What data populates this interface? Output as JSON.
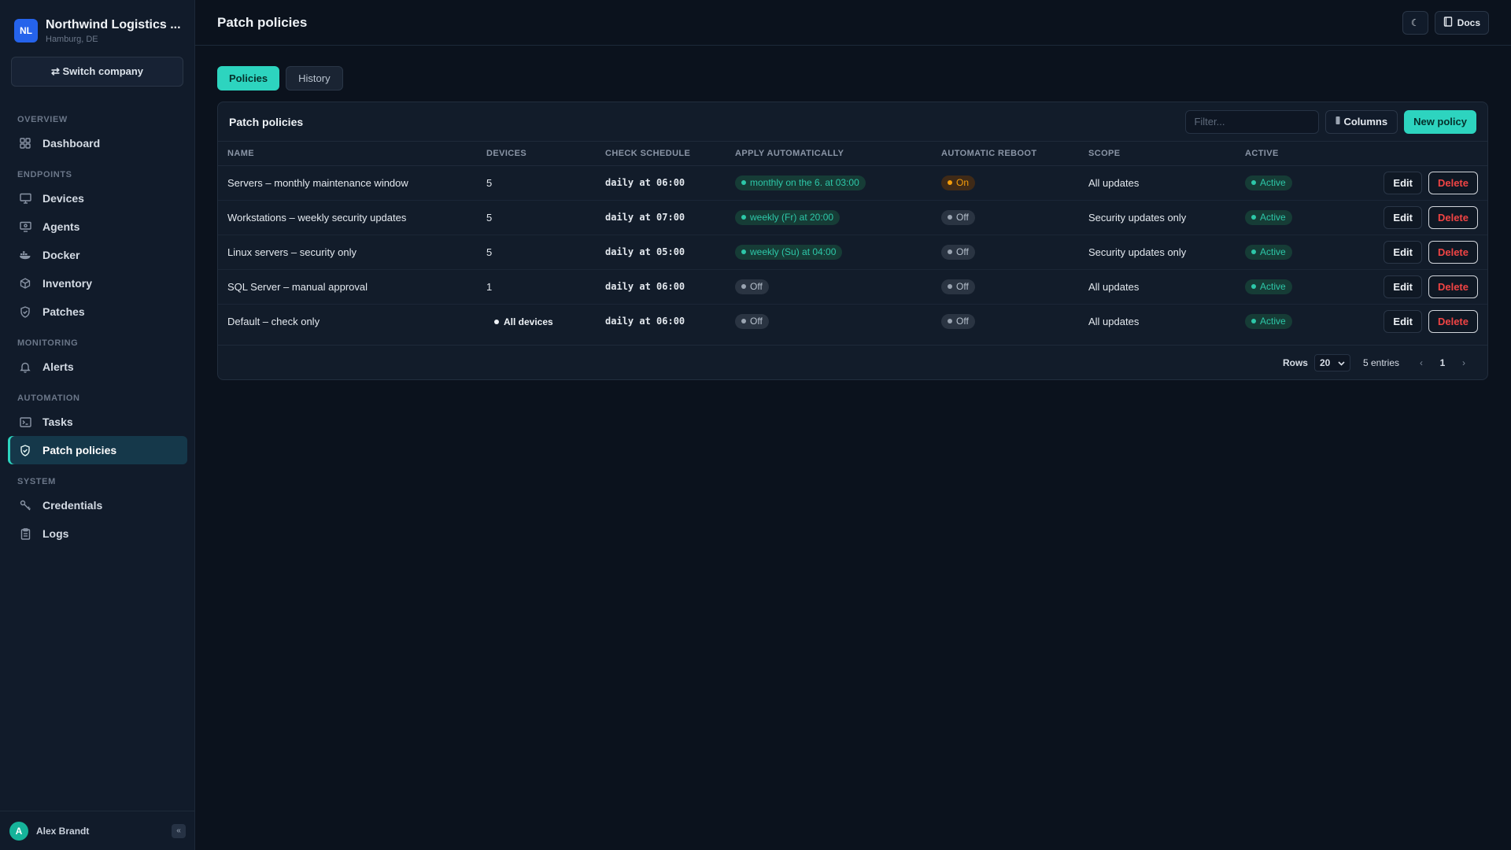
{
  "company": {
    "initials": "NL",
    "name": "Northwind Logistics ...",
    "location": "Hamburg, DE"
  },
  "switch_company": "⇄ Switch company",
  "nav": [
    {
      "section": "OVERVIEW",
      "items": [
        {
          "label": "Dashboard",
          "icon": "grid-icon"
        }
      ]
    },
    {
      "section": "ENDPOINTS",
      "items": [
        {
          "label": "Devices",
          "icon": "monitor-icon"
        },
        {
          "label": "Agents",
          "icon": "agent-icon"
        },
        {
          "label": "Docker",
          "icon": "docker-icon"
        },
        {
          "label": "Inventory",
          "icon": "box-icon"
        },
        {
          "label": "Patches",
          "icon": "shield-check-icon"
        }
      ]
    },
    {
      "section": "MONITORING",
      "items": [
        {
          "label": "Alerts",
          "icon": "bell-icon"
        }
      ]
    },
    {
      "section": "AUTOMATION",
      "items": [
        {
          "label": "Tasks",
          "icon": "terminal-icon"
        },
        {
          "label": "Patch policies",
          "icon": "shield-check-icon",
          "active": true
        }
      ]
    },
    {
      "section": "SYSTEM",
      "items": [
        {
          "label": "Credentials",
          "icon": "key-icon"
        },
        {
          "label": "Logs",
          "icon": "clipboard-icon"
        }
      ]
    }
  ],
  "user": {
    "initial": "A",
    "name": "Alex Brandt",
    "collapse": "«"
  },
  "header": {
    "title": "Patch policies",
    "theme_icon": "☾",
    "docs_label": "Docs"
  },
  "tabs": {
    "policies": "Policies",
    "history": "History"
  },
  "card": {
    "title": "Patch policies",
    "filter_placeholder": "Filter...",
    "columns_label": "Columns",
    "new_label": "New policy"
  },
  "table": {
    "headers": {
      "name": "NAME",
      "devices": "DEVICES",
      "schedule": "CHECK SCHEDULE",
      "apply": "APPLY AUTOMATICALLY",
      "reboot": "AUTOMATIC REBOOT",
      "scope": "SCOPE",
      "active": "ACTIVE"
    },
    "rows": [
      {
        "name": "Servers – monthly maintenance window",
        "devices": "5",
        "schedule": "daily at 06:00",
        "apply": "monthly on the 6. at 03:00",
        "apply_on": true,
        "reboot": "On",
        "reboot_on": true,
        "scope": "All updates",
        "active": "Active",
        "edit": "Edit",
        "delete": "Delete"
      },
      {
        "name": "Workstations – weekly security updates",
        "devices": "5",
        "schedule": "daily at 07:00",
        "apply": "weekly (Fr) at 20:00",
        "apply_on": true,
        "reboot": "Off",
        "reboot_on": false,
        "scope": "Security updates only",
        "active": "Active",
        "edit": "Edit",
        "delete": "Delete"
      },
      {
        "name": "Linux servers – security only",
        "devices": "5",
        "schedule": "daily at 05:00",
        "apply": "weekly (Su) at 04:00",
        "apply_on": true,
        "reboot": "Off",
        "reboot_on": false,
        "scope": "Security updates only",
        "active": "Active",
        "edit": "Edit",
        "delete": "Delete"
      },
      {
        "name": "SQL Server – manual approval",
        "devices": "1",
        "schedule": "daily at 06:00",
        "apply": "Off",
        "apply_on": false,
        "reboot": "Off",
        "reboot_on": false,
        "scope": "All updates",
        "active": "Active",
        "edit": "Edit",
        "delete": "Delete"
      },
      {
        "name": "Default – check only",
        "devices": "All devices",
        "devices_all": true,
        "schedule": "daily at 06:00",
        "apply": "Off",
        "apply_on": false,
        "reboot": "Off",
        "reboot_on": false,
        "scope": "All updates",
        "active": "Active",
        "edit": "Edit",
        "delete": "Delete"
      }
    ]
  },
  "footer": {
    "rows_label": "Rows",
    "rows_value": "20",
    "entries": "5 entries",
    "page": "1",
    "prev": "‹",
    "next": "›"
  },
  "colors": {
    "accent": "#2dd4bf",
    "danger": "#f04444",
    "warning": "#f59e0b",
    "brand": "#2563eb"
  }
}
